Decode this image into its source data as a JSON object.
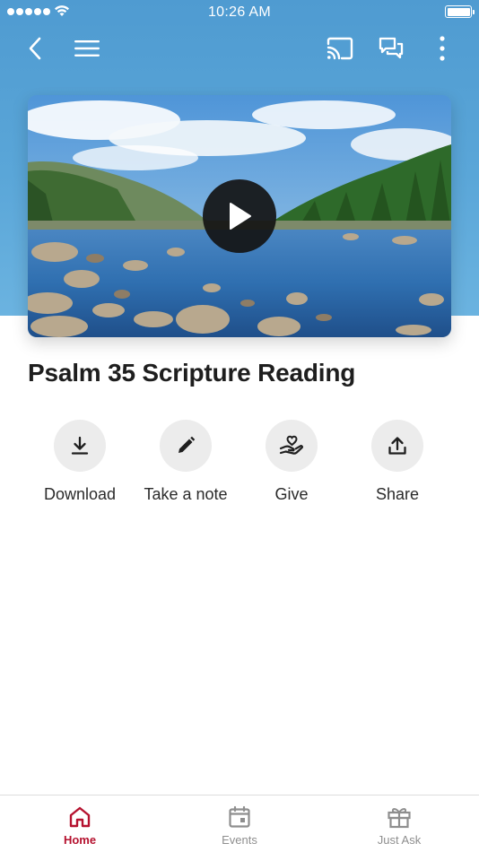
{
  "status_bar": {
    "time": "10:26 AM",
    "signal_icon": "signal-dots-icon",
    "wifi_icon": "wifi-icon",
    "battery_icon": "battery-icon",
    "battery_level": 1.0
  },
  "nav": {
    "back_icon": "chevron-left-icon",
    "menu_icon": "hamburger-menu-icon",
    "cast_icon": "cast-icon",
    "chat_icon": "chat-bubbles-icon",
    "more_icon": "more-vertical-icon"
  },
  "video": {
    "thumbnail": "lake-landscape-image",
    "play_icon": "play-icon"
  },
  "title": "Psalm 35 Scripture Reading",
  "actions": [
    {
      "label": "Download",
      "icon": "download-icon"
    },
    {
      "label": "Take a note",
      "icon": "pencil-icon"
    },
    {
      "label": "Give",
      "icon": "hand-heart-icon"
    },
    {
      "label": "Share",
      "icon": "share-icon"
    }
  ],
  "tabs": [
    {
      "label": "Home",
      "icon": "home-icon",
      "active": true
    },
    {
      "label": "Events",
      "icon": "calendar-icon",
      "active": false
    },
    {
      "label": "Just Ask",
      "icon": "gift-icon",
      "active": false
    }
  ],
  "colors": {
    "header_blue": "#5aa6d8",
    "accent": "#b5122f",
    "action_circle": "#ececec"
  }
}
